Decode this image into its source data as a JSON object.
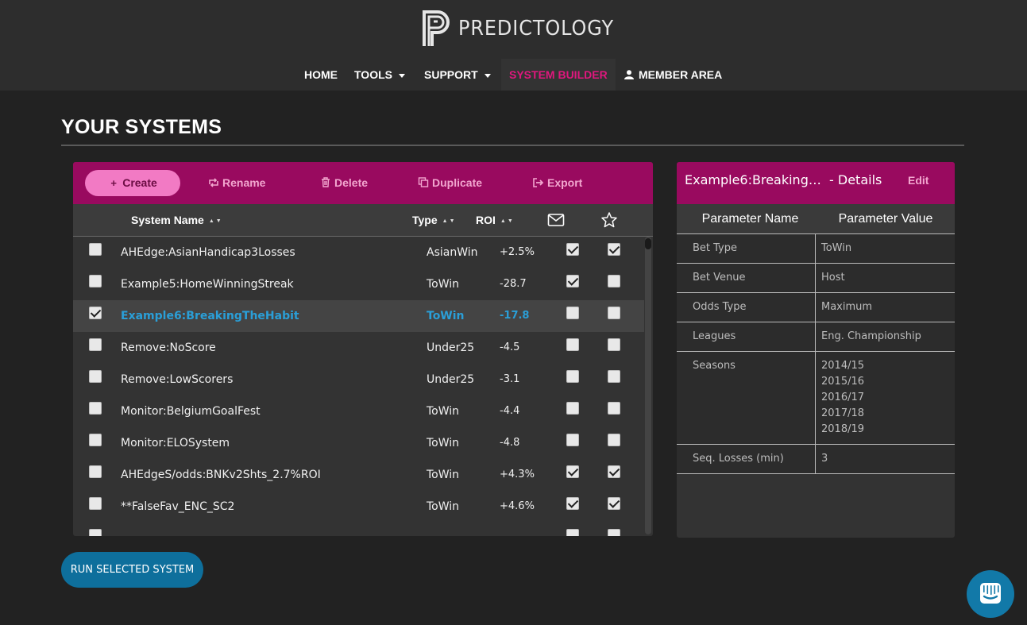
{
  "brand": {
    "name": "PREDICTOLOGY"
  },
  "nav": {
    "items": [
      {
        "label": "HOME"
      },
      {
        "label": "TOOLS"
      },
      {
        "label": "SUPPORT"
      },
      {
        "label": "SYSTEM BUILDER"
      },
      {
        "label": "MEMBER AREA"
      }
    ],
    "active_color": "#e0177e"
  },
  "page": {
    "title": "YOUR SYSTEMS"
  },
  "toolbar": {
    "create": "Create",
    "rename": "Rename",
    "delete": "Delete",
    "duplicate": "Duplicate",
    "export": "Export"
  },
  "table": {
    "columns": {
      "name": "System Name",
      "type": "Type",
      "roi": "ROI"
    },
    "rows": [
      {
        "selected": false,
        "name": "AHEdge:AsianHandicap3Losses",
        "type": "AsianWin",
        "roi": "+2.5%",
        "email": true,
        "fav": true
      },
      {
        "selected": false,
        "name": "Example5:HomeWinningStreak",
        "type": "ToWin",
        "roi": "-28.7",
        "email": true,
        "fav": false
      },
      {
        "selected": true,
        "name": "Example6:BreakingTheHabit",
        "type": "ToWin",
        "roi": "-17.8",
        "email": false,
        "fav": false
      },
      {
        "selected": false,
        "name": "Remove:NoScore",
        "type": "Under25",
        "roi": "-4.5",
        "email": false,
        "fav": false
      },
      {
        "selected": false,
        "name": "Remove:LowScorers",
        "type": "Under25",
        "roi": "-3.1",
        "email": false,
        "fav": false
      },
      {
        "selected": false,
        "name": "Monitor:BelgiumGoalFest",
        "type": "ToWin",
        "roi": "-4.4",
        "email": false,
        "fav": false
      },
      {
        "selected": false,
        "name": "Monitor:ELOSystem",
        "type": "ToWin",
        "roi": "-4.8",
        "email": false,
        "fav": false
      },
      {
        "selected": false,
        "name": "AHEdgeS/odds:BNKv2Shts_2.7%ROI",
        "type": "ToWin",
        "roi": "+4.3%",
        "email": true,
        "fav": true
      },
      {
        "selected": false,
        "name": "**FalseFav_ENC_SC2",
        "type": "ToWin",
        "roi": "+4.6%",
        "email": true,
        "fav": true
      },
      {
        "selected": false,
        "name": "",
        "type": "",
        "roi": "",
        "email": false,
        "fav": false
      }
    ]
  },
  "details": {
    "title": "Example6:Breaking…",
    "suffix": "- Details",
    "edit": "Edit",
    "col_name": "Parameter Name",
    "col_value": "Parameter Value",
    "params": [
      {
        "name": "Bet Type",
        "values": [
          "ToWin"
        ]
      },
      {
        "name": "Bet Venue",
        "values": [
          "Host"
        ]
      },
      {
        "name": "Odds Type",
        "values": [
          "Maximum"
        ]
      },
      {
        "name": "Leagues",
        "values": [
          "Eng. Championship"
        ]
      },
      {
        "name": "Seasons",
        "values": [
          "2014/15",
          "2015/16",
          "2016/17",
          "2017/18",
          "2018/19"
        ]
      },
      {
        "name": "Seq. Losses (min)",
        "values": [
          "3"
        ]
      }
    ]
  },
  "actions": {
    "run": "RUN SELECTED SYSTEM"
  },
  "colors": {
    "brand_magenta": "#990a5f",
    "create_pink": "#f27ac4",
    "selected_blue": "#2a9fd8",
    "run_blue": "#0e6f9c"
  }
}
